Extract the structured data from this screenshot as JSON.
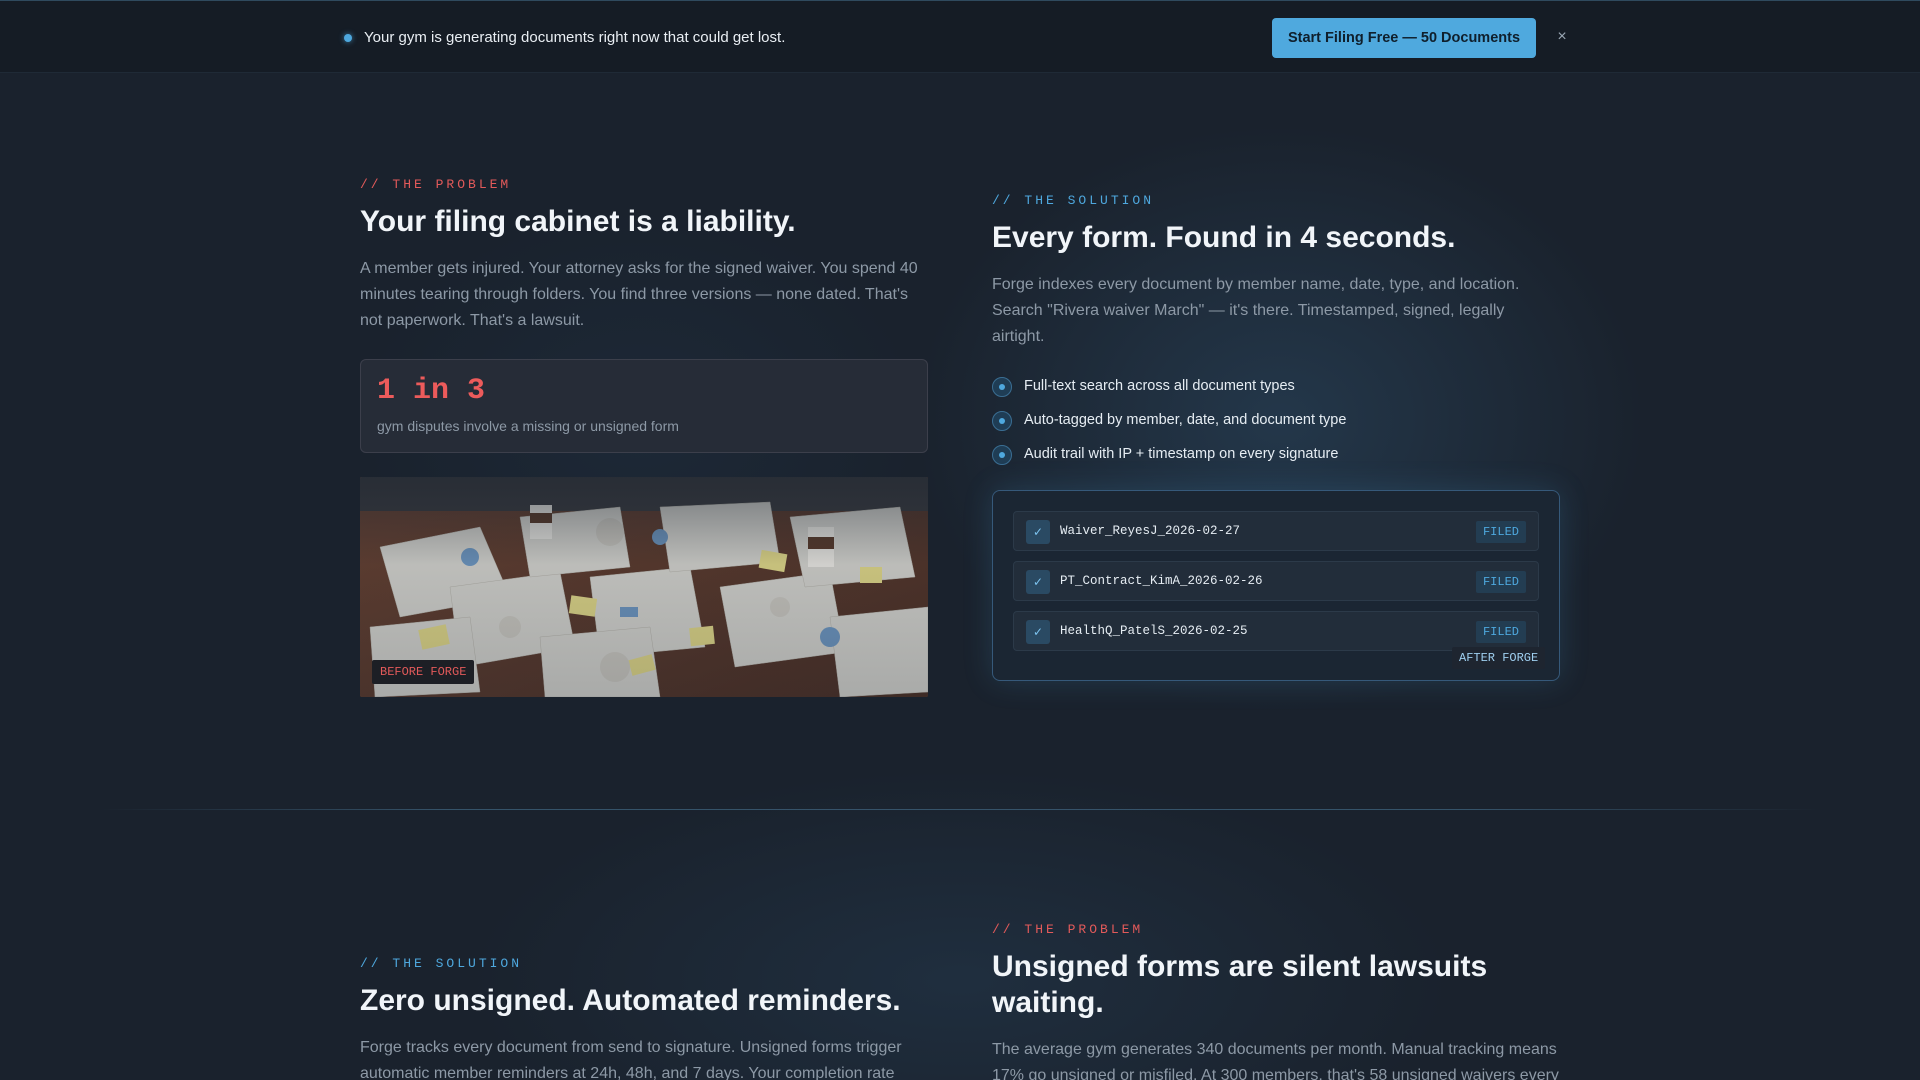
{
  "banner": {
    "message": "Your gym is generating documents right now that could get lost.",
    "cta_label": "Start Filing Free — 50 Documents",
    "close_label": "×"
  },
  "section1": {
    "problem": {
      "eyebrow": "// THE PROBLEM",
      "heading": "Your filing cabinet is a liability.",
      "body": "A member gets injured. Your attorney asks for the signed waiver. You spend 40 minutes tearing through folders. You find three versions — none dated. That's not paperwork. That's a lawsuit.",
      "stat_value": "1 in 3",
      "stat_caption": "gym disputes involve a missing or unsigned form",
      "image_tag": "BEFORE FORGE"
    },
    "solution": {
      "eyebrow": "// THE SOLUTION",
      "heading": "Every form. Found in 4 seconds.",
      "body": "Forge indexes every document by member name, date, type, and location. Search \"Rivera waiver March\" — it's there. Timestamped, signed, legally airtight.",
      "features": [
        "Full-text search across all document types",
        "Auto-tagged by member, date, and document type",
        "Audit trail with IP + timestamp on every signature"
      ],
      "files": [
        {
          "name": "Waiver_ReyesJ_2026-02-27",
          "status": "FILED",
          "check": "✓"
        },
        {
          "name": "PT_Contract_KimA_2026-02-26",
          "status": "FILED",
          "check": "✓"
        },
        {
          "name": "HealthQ_PatelS_2026-02-25",
          "status": "FILED",
          "check": "✓"
        }
      ],
      "panel_tag": "AFTER FORGE"
    }
  },
  "section2": {
    "solution": {
      "eyebrow": "// THE SOLUTION",
      "heading": "Zero unsigned. Automated reminders.",
      "body": "Forge tracks every document from send to signature. Unsigned forms trigger automatic member reminders at 24h, 48h, and 7 days. Your completion rate"
    },
    "problem": {
      "eyebrow": "// THE PROBLEM",
      "heading_line1": "Unsigned forms are silent lawsuits",
      "heading_line2": "waiting.",
      "body": "The average gym generates 340 documents per month. Manual tracking means 17% go unsigned or misfiled. At 300 members, that's 58 unsigned waivers every"
    }
  },
  "colors": {
    "background": "#1a222d",
    "accent_blue": "#4ea8de",
    "accent_red": "#e25a5a",
    "muted_text": "#8d99a6"
  },
  "icons": {
    "banner_dot": "status-dot",
    "close": "close-icon",
    "feature_bullet": "radio-dot-icon",
    "file_check": "check-icon"
  }
}
